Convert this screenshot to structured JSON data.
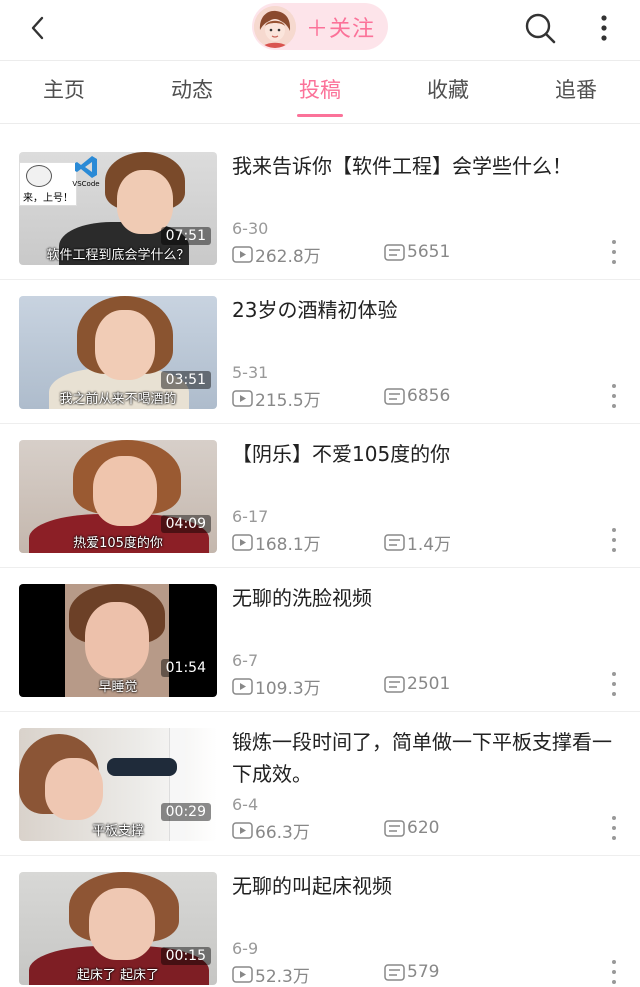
{
  "header": {
    "follow_label": "＋关注"
  },
  "tabs": [
    {
      "label": "主页",
      "active": false
    },
    {
      "label": "动态",
      "active": false
    },
    {
      "label": "投稿",
      "active": true
    },
    {
      "label": "收藏",
      "active": false
    },
    {
      "label": "追番",
      "active": false
    }
  ],
  "colors": {
    "accent": "#fb7299",
    "accent_bg": "#fde4ea",
    "text_primary": "#212121",
    "text_secondary": "#999999"
  },
  "icons": {
    "back": "back-arrow-icon",
    "search": "search-icon",
    "more": "more-vertical-icon",
    "views": "play-icon",
    "danmaku": "danmaku-icon"
  },
  "videos": [
    {
      "title": "我来告诉你【软件工程】会学些什么！",
      "date": "6-30",
      "views": "262.8万",
      "danmaku": "5651",
      "duration": "07:51",
      "caption": "软件工程到底会学什么？",
      "overlay_meme": "来，上号！",
      "overlay_logo": "VSCode"
    },
    {
      "title": "23岁の酒精初体验",
      "date": "5-31",
      "views": "215.5万",
      "danmaku": "6856",
      "duration": "03:51",
      "caption": "我之前从来不喝酒的"
    },
    {
      "title": "【阴乐】不爱105度的你",
      "date": "6-17",
      "views": "168.1万",
      "danmaku": "1.4万",
      "duration": "04:09",
      "caption": "热爱105度的你"
    },
    {
      "title": "无聊的洗脸视频",
      "date": "6-7",
      "views": "109.3万",
      "danmaku": "2501",
      "duration": "01:54",
      "caption": "早睡觉"
    },
    {
      "title": "锻炼一段时间了，简单做一下平板支撑看一下成效。",
      "date": "6-4",
      "views": "66.3万",
      "danmaku": "620",
      "duration": "00:29",
      "caption": "平板支撑"
    },
    {
      "title": "无聊的叫起床视频",
      "date": "6-9",
      "views": "52.3万",
      "danmaku": "579",
      "duration": "00:15",
      "caption": "起床了 起床了"
    }
  ]
}
